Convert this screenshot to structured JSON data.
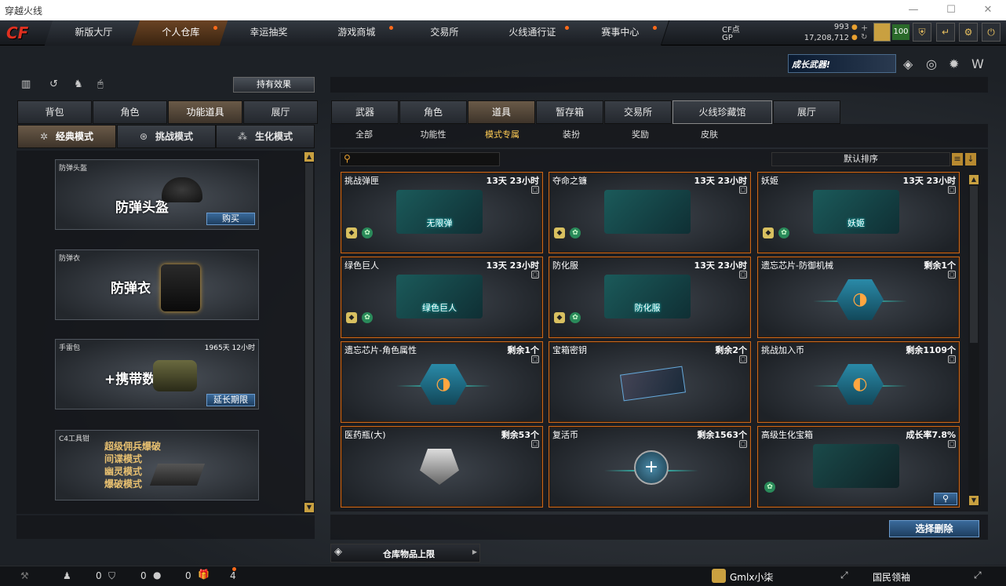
{
  "window": {
    "title": "穿越火线",
    "controls": {
      "minimize": "—",
      "maximize": "☐",
      "close": "✕"
    }
  },
  "logo": "CF",
  "nav": {
    "tabs": [
      {
        "label": "新版大厅",
        "dot": false
      },
      {
        "label": "个人仓库",
        "dot": true,
        "active": true
      },
      {
        "label": "幸运抽奖",
        "dot": false
      },
      {
        "label": "游戏商城",
        "dot": true
      },
      {
        "label": "交易所",
        "dot": false
      },
      {
        "label": "火线通行证",
        "dot": true
      },
      {
        "label": "赛事中心",
        "dot": true
      }
    ]
  },
  "currency": {
    "cf_label": "CF点",
    "cf_value": "993",
    "gp_label": "GP",
    "gp_value": "17,208,712",
    "level": "100"
  },
  "promo": {
    "banner": "成长武器!"
  },
  "left": {
    "effects_button": "持有效果",
    "tabs": [
      "背包",
      "角色",
      "功能道具",
      "展厅"
    ],
    "active_tab": 2,
    "modes": [
      "经典模式",
      "挑战模式",
      "生化模式"
    ],
    "items": [
      {
        "name": "防弹头盔",
        "big": "防弹头盔",
        "button": "购买"
      },
      {
        "name": "防弹衣",
        "big": "防弹衣"
      },
      {
        "name": "手雷包",
        "big": "+携带数",
        "time": "1965天 12小时",
        "button": "延长期限"
      },
      {
        "name": "C4工具钳",
        "lines": [
          "超级佣兵爆破",
          "间谍模式",
          "幽灵模式",
          "爆破模式"
        ]
      }
    ]
  },
  "right": {
    "tabs": [
      "武器",
      "角色",
      "道具",
      "暂存箱",
      "交易所",
      "火线珍藏馆",
      "展厅"
    ],
    "active_tab": 2,
    "subtabs": [
      "全部",
      "功能性",
      "模式专属",
      "装扮",
      "奖励",
      "皮肤"
    ],
    "active_subtab": 2,
    "search": {
      "placeholder": ""
    },
    "sort_label": "默认排序",
    "items": [
      {
        "name": "挑战弹匣",
        "status": "13天 23小时",
        "pic_text": "无限弹",
        "badges": 2
      },
      {
        "name": "夺命之镰",
        "status": "13天 23小时",
        "badges": 2
      },
      {
        "name": "妖姬",
        "status": "13天 23小时",
        "pic_text": "妖姬",
        "badges": 2
      },
      {
        "name": "绿色巨人",
        "status": "13天 23小时",
        "pic_text": "绿色巨人",
        "badges": 2
      },
      {
        "name": "防化服",
        "status": "13天 23小时",
        "pic_text": "防化服",
        "badges": 2
      },
      {
        "name": "遗忘芯片-防御机械",
        "status": "剩余1个",
        "badges": 0
      },
      {
        "name": "遗忘芯片-角色属性",
        "status": "剩余1个",
        "badges": 0
      },
      {
        "name": "宝箱密钥",
        "status": "剩余2个",
        "badges": 0
      },
      {
        "name": "挑战加入币",
        "status": "剩余1109个",
        "badges": 0
      },
      {
        "name": "医药瓶(大)",
        "status": "剩余53个",
        "badges": 0
      },
      {
        "name": "复活币",
        "status": "剩余1563个",
        "badges": 0
      },
      {
        "name": "高级生化宝箱",
        "status": "成长率7.8%",
        "badges": 1
      }
    ],
    "delete_button": "选择删除",
    "storage_limit": "仓库物品上限"
  },
  "footer": {
    "counts": [
      "0",
      "0",
      "0",
      "4"
    ],
    "user": "Gmlx小柒",
    "channel": "国民领袖"
  }
}
